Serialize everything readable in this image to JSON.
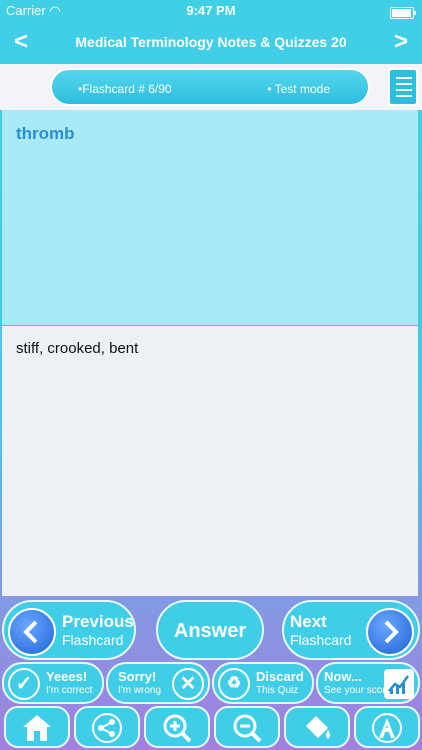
{
  "status": {
    "carrier": "Carrier",
    "time": "9:47 PM"
  },
  "nav": {
    "title": "Medical Terminology Notes & Quizzes 20",
    "back": "<",
    "forward": ">"
  },
  "mode": {
    "flashcard": "•Flashcard #  6/90",
    "test": "• Test mode"
  },
  "card": {
    "term": "thromb",
    "answer": "stiff, crooked, bent"
  },
  "controls": {
    "previous": {
      "main": "Previous",
      "sub": "Flashcard"
    },
    "answer": "Answer",
    "next": {
      "main": "Next",
      "sub": "Flashcard"
    },
    "yes": {
      "main": "Yeees!",
      "sub": "I'm correct"
    },
    "sorry": {
      "main": "Sorry!",
      "sub": "I'm wrong"
    },
    "discard": {
      "main": "Discard",
      "sub": "This Quiz"
    },
    "now": {
      "main": "Now...",
      "sub": "See your score"
    }
  },
  "toolbar": [
    "home-icon",
    "share-icon",
    "zoom-in-icon",
    "zoom-out-icon",
    "paint-bucket-icon",
    "font-icon"
  ],
  "colors": {
    "accent": "#40cde7",
    "term_text": "#2a8fd0",
    "term_bg": "#a9eaf6",
    "answer_bg": "#eef1f4"
  }
}
